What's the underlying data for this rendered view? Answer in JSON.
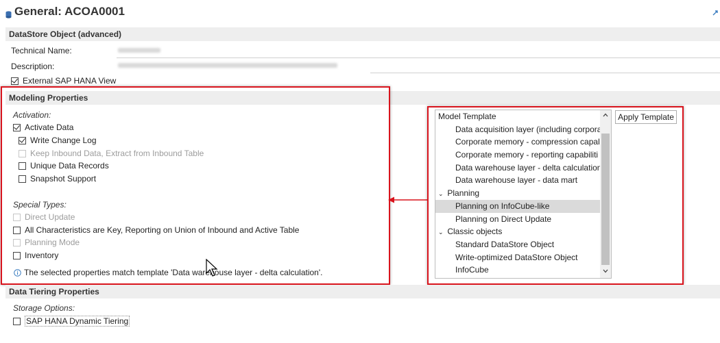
{
  "header": {
    "title": "General: ACOA0001"
  },
  "datastore_section": {
    "heading": "DataStore Object (advanced)",
    "technical_name_label": "Technical Name:",
    "description_label": "Description:",
    "external_view_label": "External SAP HANA View",
    "external_view_checked": true
  },
  "modeling": {
    "heading": "Modeling Properties",
    "activation_label": "Activation:",
    "activate_data": "Activate Data",
    "write_change_log": "Write Change Log",
    "keep_inbound": "Keep Inbound Data, Extract from Inbound Table",
    "unique_records": "Unique Data Records",
    "snapshot_support": "Snapshot Support",
    "special_types_label": "Special Types:",
    "direct_update": "Direct Update",
    "all_characteristics": "All Characteristics are Key, Reporting on Union of Inbound and Active Table",
    "planning_mode": "Planning Mode",
    "inventory": "Inventory",
    "info_text": "The selected properties match template 'Data warehouse layer - delta calculation'."
  },
  "template_panel": {
    "header": "Model Template",
    "apply_button": "Apply Template",
    "items": [
      "Data acquisition layer (including corpora",
      "Corporate memory - compression capal",
      "Corporate memory - reporting capabiliti",
      "Data warehouse layer - delta calculation",
      "Data warehouse layer - data mart"
    ],
    "planning_group": "Planning",
    "planning_items": [
      "Planning on InfoCube-like",
      "Planning on Direct Update"
    ],
    "classic_group": "Classic objects",
    "classic_items": [
      "Standard DataStore Object",
      "Write-optimized DataStore Object",
      "InfoCube"
    ]
  },
  "tiering": {
    "heading": "Data Tiering Properties",
    "storage_label": "Storage Options:",
    "dynamic_tiering": "SAP HANA Dynamic Tiering"
  },
  "colors": {
    "highlight_border": "#d9131c",
    "section_bg": "#eeeeee",
    "selected_row": "#dadada"
  }
}
